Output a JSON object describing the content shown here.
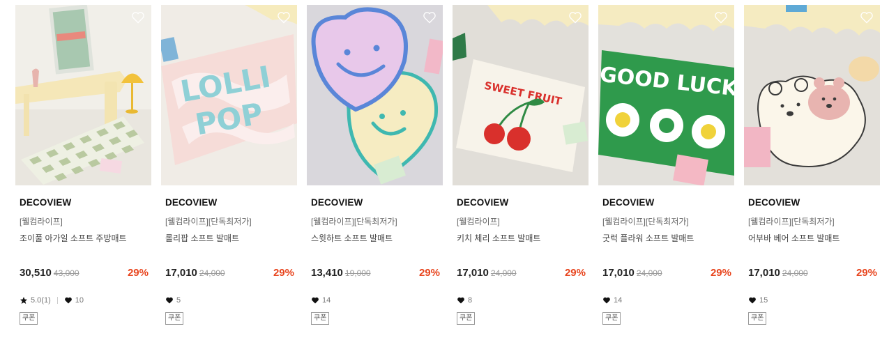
{
  "products": [
    {
      "brand": "DECOVIEW",
      "tag": "[웰컴라이프]",
      "name": "조이풀 아가일 소프트 주방매트",
      "price": "30,510",
      "original_price": "43,000",
      "discount": "29%",
      "rating": "5.0(1)",
      "likes": "10",
      "coupon": "쿠폰",
      "image_icon": "kitchen-checker-mat-image"
    },
    {
      "brand": "DECOVIEW",
      "tag": "[웰컴라이프][단독최저가]",
      "name": "롤리팝 소프트 발매트",
      "price": "17,010",
      "original_price": "24,000",
      "discount": "29%",
      "likes": "5",
      "coupon": "쿠폰",
      "image_icon": "lollipop-mat-image"
    },
    {
      "brand": "DECOVIEW",
      "tag": "[웰컴라이프][단독최저가]",
      "name": "스윗하트 소프트 발매트",
      "price": "13,410",
      "original_price": "19,000",
      "discount": "29%",
      "likes": "14",
      "coupon": "쿠폰",
      "image_icon": "sweetheart-mat-image"
    },
    {
      "brand": "DECOVIEW",
      "tag": "[웰컴라이프]",
      "name": "키치 체리 소프트 발매트",
      "price": "17,010",
      "original_price": "24,000",
      "discount": "29%",
      "likes": "8",
      "coupon": "쿠폰",
      "image_icon": "cherry-mat-image"
    },
    {
      "brand": "DECOVIEW",
      "tag": "[웰컴라이프][단독최저가]",
      "name": "굿럭 플라워 소프트 발매트",
      "price": "17,010",
      "original_price": "24,000",
      "discount": "29%",
      "likes": "14",
      "coupon": "쿠폰",
      "image_icon": "good-luck-mat-image"
    },
    {
      "brand": "DECOVIEW",
      "tag": "[웰컴라이프][단독최저가]",
      "name": "어부바 베어 소프트 발매트",
      "price": "17,010",
      "original_price": "24,000",
      "discount": "29%",
      "likes": "15",
      "coupon": "쿠폰",
      "image_icon": "bear-mat-image"
    }
  ],
  "image_text": {
    "lollipop": [
      "LOLLI",
      "POP"
    ],
    "cherry": "SWEET FRUIT",
    "good_luck": "GOOD LUCK"
  },
  "colors": {
    "discount": "#e8451e",
    "text": "#222222",
    "muted": "#999999"
  }
}
